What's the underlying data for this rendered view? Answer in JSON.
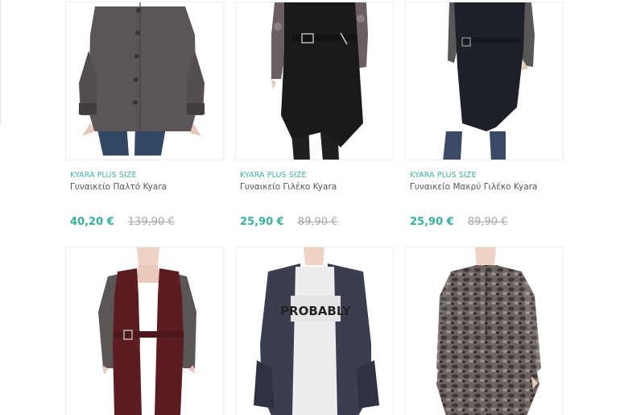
{
  "products": [
    {
      "brand": "KYARA PLUS SIZE",
      "title": "Γυναικείο Παλτό Kyara",
      "price": "40,20 €",
      "old_price": "139,90 €",
      "image": "coat-photo"
    },
    {
      "brand": "KYARA PLUS SIZE",
      "title": "Γυναικείο Γιλέκο Kyara",
      "price": "25,90 €",
      "old_price": "89,90 €",
      "image": "black-vest-photo"
    },
    {
      "brand": "KYARA PLUS SIZE",
      "title": "Γυναικείο Μακρύ Γιλέκο Kyara",
      "price": "25,90 €",
      "old_price": "89,90 €",
      "image": "long-black-vest-photo"
    },
    {
      "image": "burgundy-vest-photo"
    },
    {
      "image": "jacket-tshirt-photo",
      "tshirt_text": "PROBABLY"
    },
    {
      "image": "snake-print-dress-photo"
    }
  ],
  "colors": {
    "accent": "#39b09c",
    "old_price": "#a9a9a9",
    "title": "#555555",
    "border": "#ececec"
  }
}
